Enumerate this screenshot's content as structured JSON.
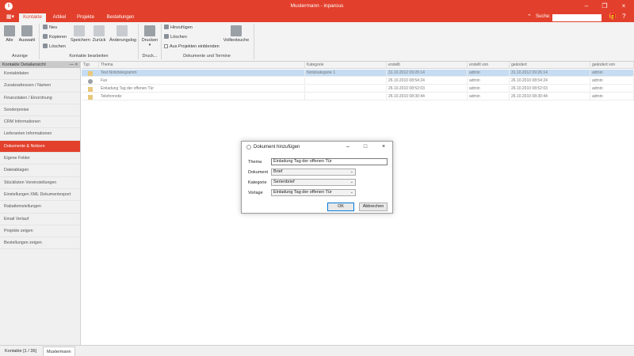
{
  "window": {
    "title": "Mustermann - inparous"
  },
  "tabs": [
    {
      "label": "Kontakte",
      "active": true
    },
    {
      "label": "Artikel",
      "active": false
    },
    {
      "label": "Projekte",
      "active": false
    },
    {
      "label": "Bestellungen",
      "active": false
    }
  ],
  "search": {
    "label": "Suche:",
    "value": ""
  },
  "ribbon": {
    "anzeige": {
      "label": "Anzeige",
      "alle": "Alle",
      "auswahl": "Auswahl"
    },
    "kontakte_bearbeiten": {
      "label": "Kontakte bearbeiten",
      "neu": "Neu",
      "kopieren": "Kopieren",
      "loeschen": "Löschen",
      "speichern": "Speichern",
      "zurueck": "Zurück",
      "aenderungslog": "Änderungslog"
    },
    "druck": {
      "label": "Druck...",
      "drucken": "Drucken"
    },
    "dokumente": {
      "label": "Dokumente und Termine",
      "hinzufuegen": "Hinzufügen",
      "loeschen": "Löschen",
      "aus_projekten": "Aus Projekten einblenden",
      "volltextsuche": "Volltextsuche"
    }
  },
  "sidebar": {
    "header": "Kontakte Detailansicht",
    "pin": "— ×",
    "items": [
      {
        "label": "Kontaktdaten"
      },
      {
        "label": "Zusatzadressen / Namen"
      },
      {
        "label": "Finanzdaten / Einordnung"
      },
      {
        "label": "Sonderpreise"
      },
      {
        "label": "CRM Informationen"
      },
      {
        "label": "Lieferanten Informationen"
      },
      {
        "label": "Dokumente & Notizen",
        "active": true
      },
      {
        "label": "Eigene Felder"
      },
      {
        "label": "Dateiablagen"
      },
      {
        "label": "Stücklisten Voreinstellungen"
      },
      {
        "label": "Einstellungen XML Dokumentexport"
      },
      {
        "label": "Rabatteinstellungen"
      },
      {
        "label": "Email Verlauf"
      },
      {
        "label": "Projekte zeigen"
      },
      {
        "label": "Bestellungen zeigen"
      }
    ]
  },
  "grid": {
    "columns": [
      "Typ",
      "Thema",
      "Kategorie",
      "erstellt",
      "erstellt von",
      "geändert",
      "geändert von"
    ],
    "rows": [
      {
        "thema": "Test Notiztelegramm",
        "kategorie": "Notizkategorie 1",
        "erstellt": "31.10.2012 09:26:14",
        "erstellt_von": "admin",
        "geaendert": "31.10.2012 09:26:14",
        "geaendert_von": "admin",
        "selected": true,
        "icon_color": "#e8c87a"
      },
      {
        "thema": "Fax",
        "kategorie": "",
        "erstellt": "26.10.2010 08:54:24",
        "erstellt_von": "admin",
        "geaendert": "26.10.2010 08:54:24",
        "geaendert_von": "admin",
        "selected": false,
        "icon_color": "#9aa0a6"
      },
      {
        "thema": "Einladung Tag der offenen Tür",
        "kategorie": "",
        "erstellt": "26.10.2010 08:52:03",
        "erstellt_von": "admin",
        "geaendert": "26.10.2010 08:52:03",
        "geaendert_von": "admin",
        "selected": false,
        "icon_color": "#e8c87a"
      },
      {
        "thema": "Telefonnotiz",
        "kategorie": "",
        "erstellt": "26.10.2010 08:30:44",
        "erstellt_von": "admin",
        "geaendert": "26.10.2010 08:30:44",
        "geaendert_von": "admin",
        "selected": false,
        "icon_color": "#e8c87a"
      }
    ]
  },
  "statusbar": {
    "tab1": "Kontakte [1 / 36]",
    "tab2": "Mustermann"
  },
  "dialog": {
    "title": "Dokument hinzufügen",
    "thema_label": "Thema",
    "thema_value": "Einladung Tag der offenen Tür",
    "dokument_label": "Dokument",
    "dokument_value": "Brief",
    "kategorie_label": "Kategorie",
    "kategorie_value": "Serienbrief",
    "vorlage_label": "Vorlage",
    "vorlage_value": "Einladung Tag der offenen Tür",
    "ok_label": "OK",
    "cancel_label": "Abbrechen"
  },
  "colors": {
    "brand": "#e2402c",
    "selection": "#c5dcf2"
  }
}
